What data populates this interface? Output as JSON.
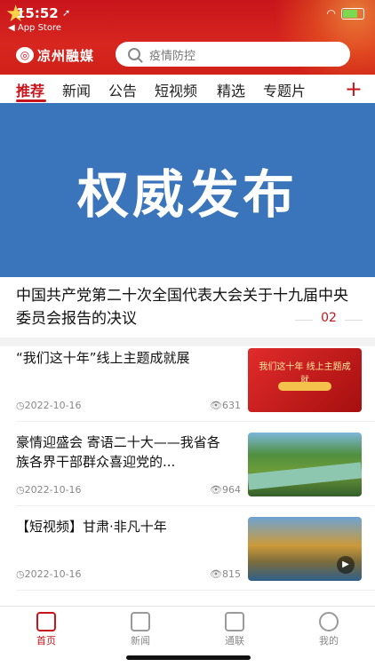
{
  "status": {
    "time": "15:52",
    "back": "◀ App Store"
  },
  "brand": {
    "name": "凉州融媒",
    "mark_text": "◎"
  },
  "search": {
    "placeholder": "疫情防控"
  },
  "tabs": [
    "推荐",
    "新闻",
    "公告",
    "短视频",
    "精选",
    "专题片"
  ],
  "tab_more": "+",
  "banner": {
    "text": "权威发布"
  },
  "headline": {
    "title": "中国共产党第二十次全国代表大会关于十九届中央委员会报告的决议",
    "page": "02"
  },
  "news": [
    {
      "title": "“我们这十年”线上主题成就展",
      "date": "2022-10-16",
      "views": "631",
      "thumb_caption": "我们这十年 线上主题成就"
    },
    {
      "title": "豪情迎盛会 寄语二十大——我省各族各界干部群众喜迎党的...",
      "date": "2022-10-16",
      "views": "964"
    },
    {
      "title": "【短视频】甘肃·非凡十年",
      "date": "2022-10-16",
      "views": "815"
    }
  ],
  "bottom_nav": [
    "首页",
    "新闻",
    "通联",
    "我的"
  ],
  "colors": {
    "brand_red": "#c8141b",
    "banner_blue": "#3a74bb"
  }
}
